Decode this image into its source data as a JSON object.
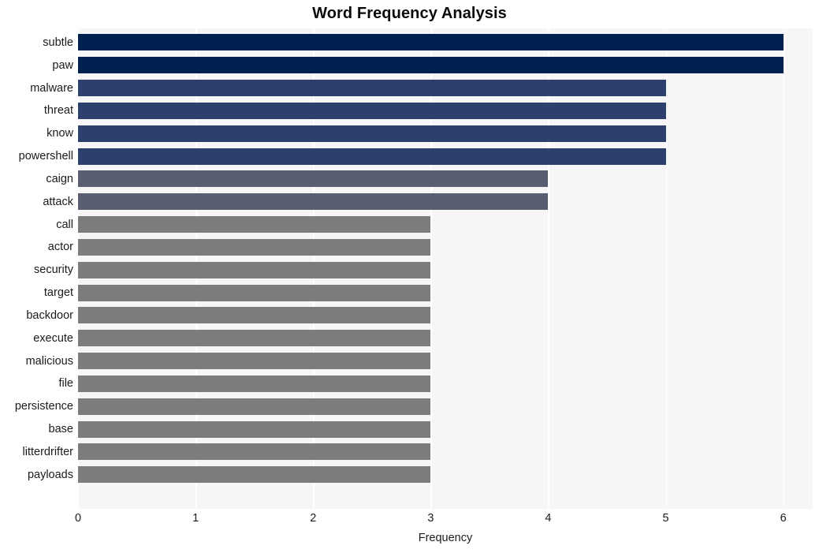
{
  "chart_data": {
    "type": "bar",
    "orientation": "horizontal",
    "title": "Word Frequency Analysis",
    "xlabel": "Frequency",
    "ylabel": "",
    "xlim": [
      0,
      6.25
    ],
    "xticks": [
      "0",
      "1",
      "2",
      "3",
      "4",
      "5",
      "6"
    ],
    "xtick_values": [
      0,
      1,
      2,
      3,
      4,
      5,
      6
    ],
    "grid": true,
    "grid_axis": "x",
    "legend": "none",
    "categories": [
      "subtle",
      "paw",
      "malware",
      "threat",
      "know",
      "powershell",
      "caign",
      "attack",
      "call",
      "actor",
      "security",
      "target",
      "backdoor",
      "execute",
      "malicious",
      "file",
      "persistence",
      "base",
      "litterdrifter",
      "payloads"
    ],
    "values": [
      6,
      6,
      5,
      5,
      5,
      5,
      4,
      4,
      3,
      3,
      3,
      3,
      3,
      3,
      3,
      3,
      3,
      3,
      3,
      3
    ],
    "bar_colors": [
      "#002050",
      "#002050",
      "#2d3f6d",
      "#2d3f6d",
      "#2d3f6d",
      "#2d3f6d",
      "#595e71",
      "#595e71",
      "#7c7c7a",
      "#7c7c7a",
      "#7c7c7a",
      "#7c7c7a",
      "#7c7c7a",
      "#7c7c7a",
      "#7c7c7a",
      "#7c7c7a",
      "#7c7c7a",
      "#7c7c7a",
      "#7c7c7a",
      "#7c7c7a"
    ],
    "plot_background": "#f6f6f7",
    "figure_background": "#ffffff",
    "gridline_color": "#ffffff"
  }
}
